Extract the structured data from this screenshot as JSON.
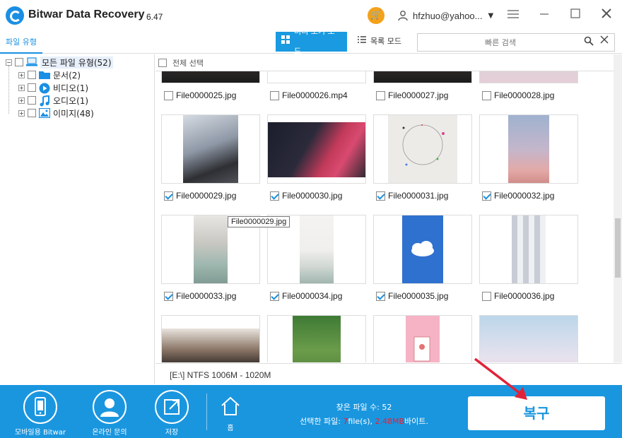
{
  "app": {
    "title": "Bitwar Data Recovery",
    "version": "6.47"
  },
  "header": {
    "user_name": "hfzhuo@yahoo...",
    "cart_icon": "cart-icon",
    "menu_icon": "hamburger-icon",
    "minimize_icon": "minimize-icon",
    "maximize_icon": "maximize-icon",
    "close_icon": "close-icon"
  },
  "toolbar": {
    "file_type_tab": "파일 유형",
    "preview_mode": "미리 보기 모드",
    "list_mode": "목록 모드",
    "search_placeholder": "빠른 검색"
  },
  "tree": {
    "root": {
      "label": "모든 파일 유형(52)"
    },
    "items": [
      {
        "label": "문서(2)",
        "icon": "folder-icon"
      },
      {
        "label": "비디오(1)",
        "icon": "video-icon"
      },
      {
        "label": "오디오(1)",
        "icon": "music-icon"
      },
      {
        "label": "이미지(48)",
        "icon": "image-icon"
      }
    ]
  },
  "grid": {
    "select_all": "전체 선택",
    "tooltip": "File0000029.jpg",
    "rows": [
      [
        {
          "name": "File0000025.jpg",
          "checked": false
        },
        {
          "name": "File0000026.mp4",
          "checked": false
        },
        {
          "name": "File0000027.jpg",
          "checked": false
        },
        {
          "name": "File0000028.jpg",
          "checked": false
        }
      ],
      [
        {
          "name": "File0000029.jpg",
          "checked": true
        },
        {
          "name": "File0000030.jpg",
          "checked": true
        },
        {
          "name": "File0000031.jpg",
          "checked": true
        },
        {
          "name": "File0000032.jpg",
          "checked": true
        }
      ],
      [
        {
          "name": "File0000033.jpg",
          "checked": true
        },
        {
          "name": "File0000034.jpg",
          "checked": true
        },
        {
          "name": "File0000035.jpg",
          "checked": true
        },
        {
          "name": "File0000036.jpg",
          "checked": false
        }
      ]
    ]
  },
  "status": {
    "partition": "[E:\\] NTFS 1006M - 1020M"
  },
  "bottom": {
    "mobile_label": "모바일용 Bitwar",
    "online_label": "온라인 문의",
    "save_label": "저장",
    "home_label": "홈",
    "found_label": "찾은 파일 수: 52",
    "selected_prefix": "선택한 파일: ",
    "selected_count": "7",
    "selected_mid": "file(s), ",
    "selected_size": "2.48MB",
    "selected_suffix": "바이트.",
    "recover_label": "복구"
  },
  "colors": {
    "accent": "#1a96df",
    "cart": "#f3a21b",
    "highlight": "#e0233a"
  }
}
